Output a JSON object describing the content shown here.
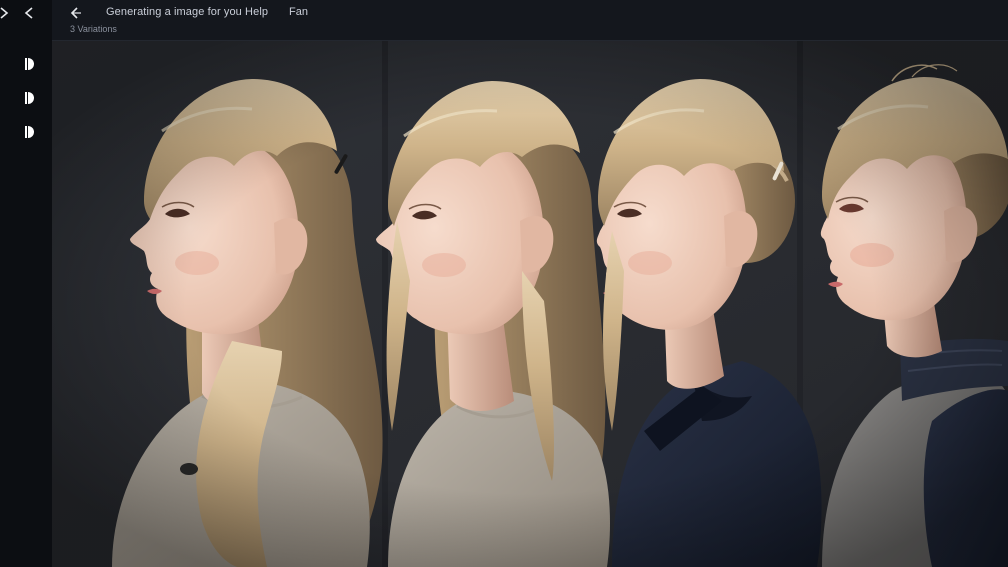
{
  "window": {
    "title": "Generating a image for you Help",
    "menu_label": "Fan",
    "subtitle": "3 Variations"
  },
  "rail": {
    "nav": [
      {
        "icon": "chevron-right-icon"
      },
      {
        "icon": "chevron-left-icon"
      }
    ],
    "tools": [
      {
        "icon": "half-circle-icon"
      },
      {
        "icon": "half-circle-icon"
      },
      {
        "icon": "half-circle-icon"
      }
    ]
  },
  "canvas": {
    "image_alt": "Four side-profile portraits of a blonde girl",
    "panels": [
      {
        "hair": "long-loose",
        "top": "beige-knit"
      },
      {
        "hair": "long-loose",
        "top": "beige-knit"
      },
      {
        "hair": "bun",
        "top": "navy-sweater"
      },
      {
        "hair": "bun",
        "top": "gray-turtleneck"
      }
    ]
  },
  "colors": {
    "app_bg": "#16181d",
    "rail_bg": "#0c0e12",
    "hair": "#d8c09a",
    "skin": "#efcfbf",
    "navy": "#1d2436",
    "beige": "#b3aca2"
  }
}
